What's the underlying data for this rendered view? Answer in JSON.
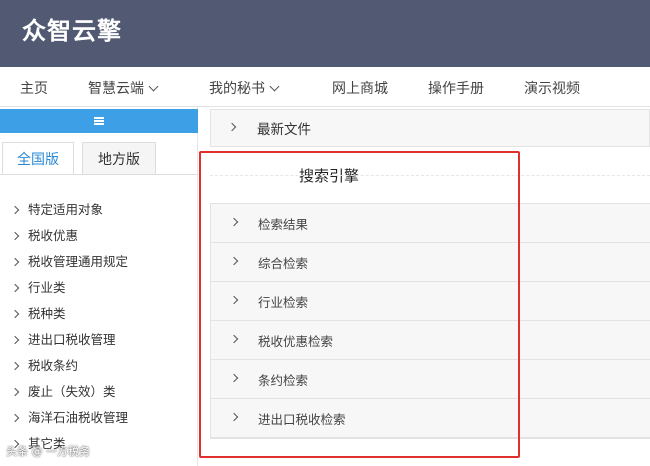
{
  "app": {
    "logo": "众智云擎"
  },
  "nav": [
    {
      "label": "主页",
      "dropdown": false
    },
    {
      "label": "智慧云端",
      "dropdown": true
    },
    {
      "label": "我的秘书",
      "dropdown": true
    },
    {
      "label": "网上商城",
      "dropdown": false
    },
    {
      "label": "操作手册",
      "dropdown": false
    },
    {
      "label": "演示视频",
      "dropdown": false
    }
  ],
  "sidebar": {
    "tabs": [
      {
        "label": "全国版",
        "active": true
      },
      {
        "label": "地方版",
        "active": false
      }
    ],
    "items": [
      {
        "label": "特定适用对象"
      },
      {
        "label": "税收优惠"
      },
      {
        "label": "税收管理通用规定"
      },
      {
        "label": "行业类"
      },
      {
        "label": "税种类"
      },
      {
        "label": "进出口税收管理"
      },
      {
        "label": "税收条约"
      },
      {
        "label": "废止（失效）类"
      },
      {
        "label": "海洋石油税收管理"
      },
      {
        "label": "其它类"
      }
    ]
  },
  "main": {
    "latest_files": "最新文件",
    "search_title": "搜索引擎",
    "search_items": [
      {
        "label": "检索结果"
      },
      {
        "label": "综合检索"
      },
      {
        "label": "行业检索"
      },
      {
        "label": "税收优惠检索"
      },
      {
        "label": "条约检索"
      },
      {
        "label": "进出口税收检索"
      }
    ]
  },
  "watermark": "头条 @ 一方税务",
  "colors": {
    "header_bg": "#525a73",
    "accent_blue": "#3da0e6",
    "highlight_red": "#e0302d"
  }
}
